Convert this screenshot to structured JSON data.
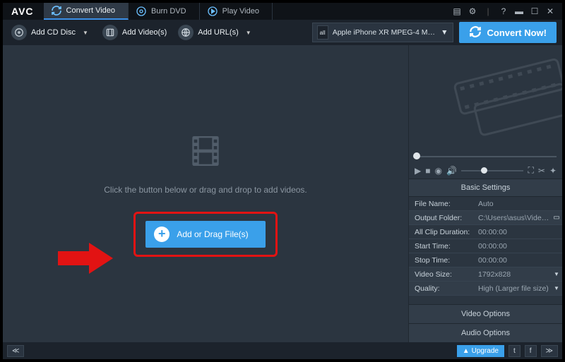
{
  "app": {
    "logo": "AVC"
  },
  "tabs": [
    {
      "label": "Convert Video"
    },
    {
      "label": "Burn DVD"
    },
    {
      "label": "Play Video"
    }
  ],
  "toolbar": {
    "add_cd": "Add CD Disc",
    "add_videos": "Add Video(s)",
    "add_urls": "Add URL(s)",
    "profile": "Apple iPhone XR MPEG-4 Movie (*.m…",
    "convert": "Convert Now!"
  },
  "main": {
    "hint": "Click the button below or drag and drop to add videos.",
    "add_button": "Add or Drag File(s)"
  },
  "settings": {
    "header": "Basic Settings",
    "file_name": {
      "k": "File Name:",
      "v": "Auto"
    },
    "output_folder": {
      "k": "Output Folder:",
      "v": "C:\\Users\\asus\\Videos\\…"
    },
    "all_clip": {
      "k": "All Clip Duration:",
      "v": "00:00:00"
    },
    "start_time": {
      "k": "Start Time:",
      "v": "00:00:00"
    },
    "stop_time": {
      "k": "Stop Time:",
      "v": "00:00:00"
    },
    "video_size": {
      "k": "Video Size:",
      "v": "1792x828"
    },
    "quality": {
      "k": "Quality:",
      "v": "High (Larger file size)"
    }
  },
  "side_options": {
    "video": "Video Options",
    "audio": "Audio Options"
  },
  "status": {
    "upgrade": "Upgrade"
  }
}
